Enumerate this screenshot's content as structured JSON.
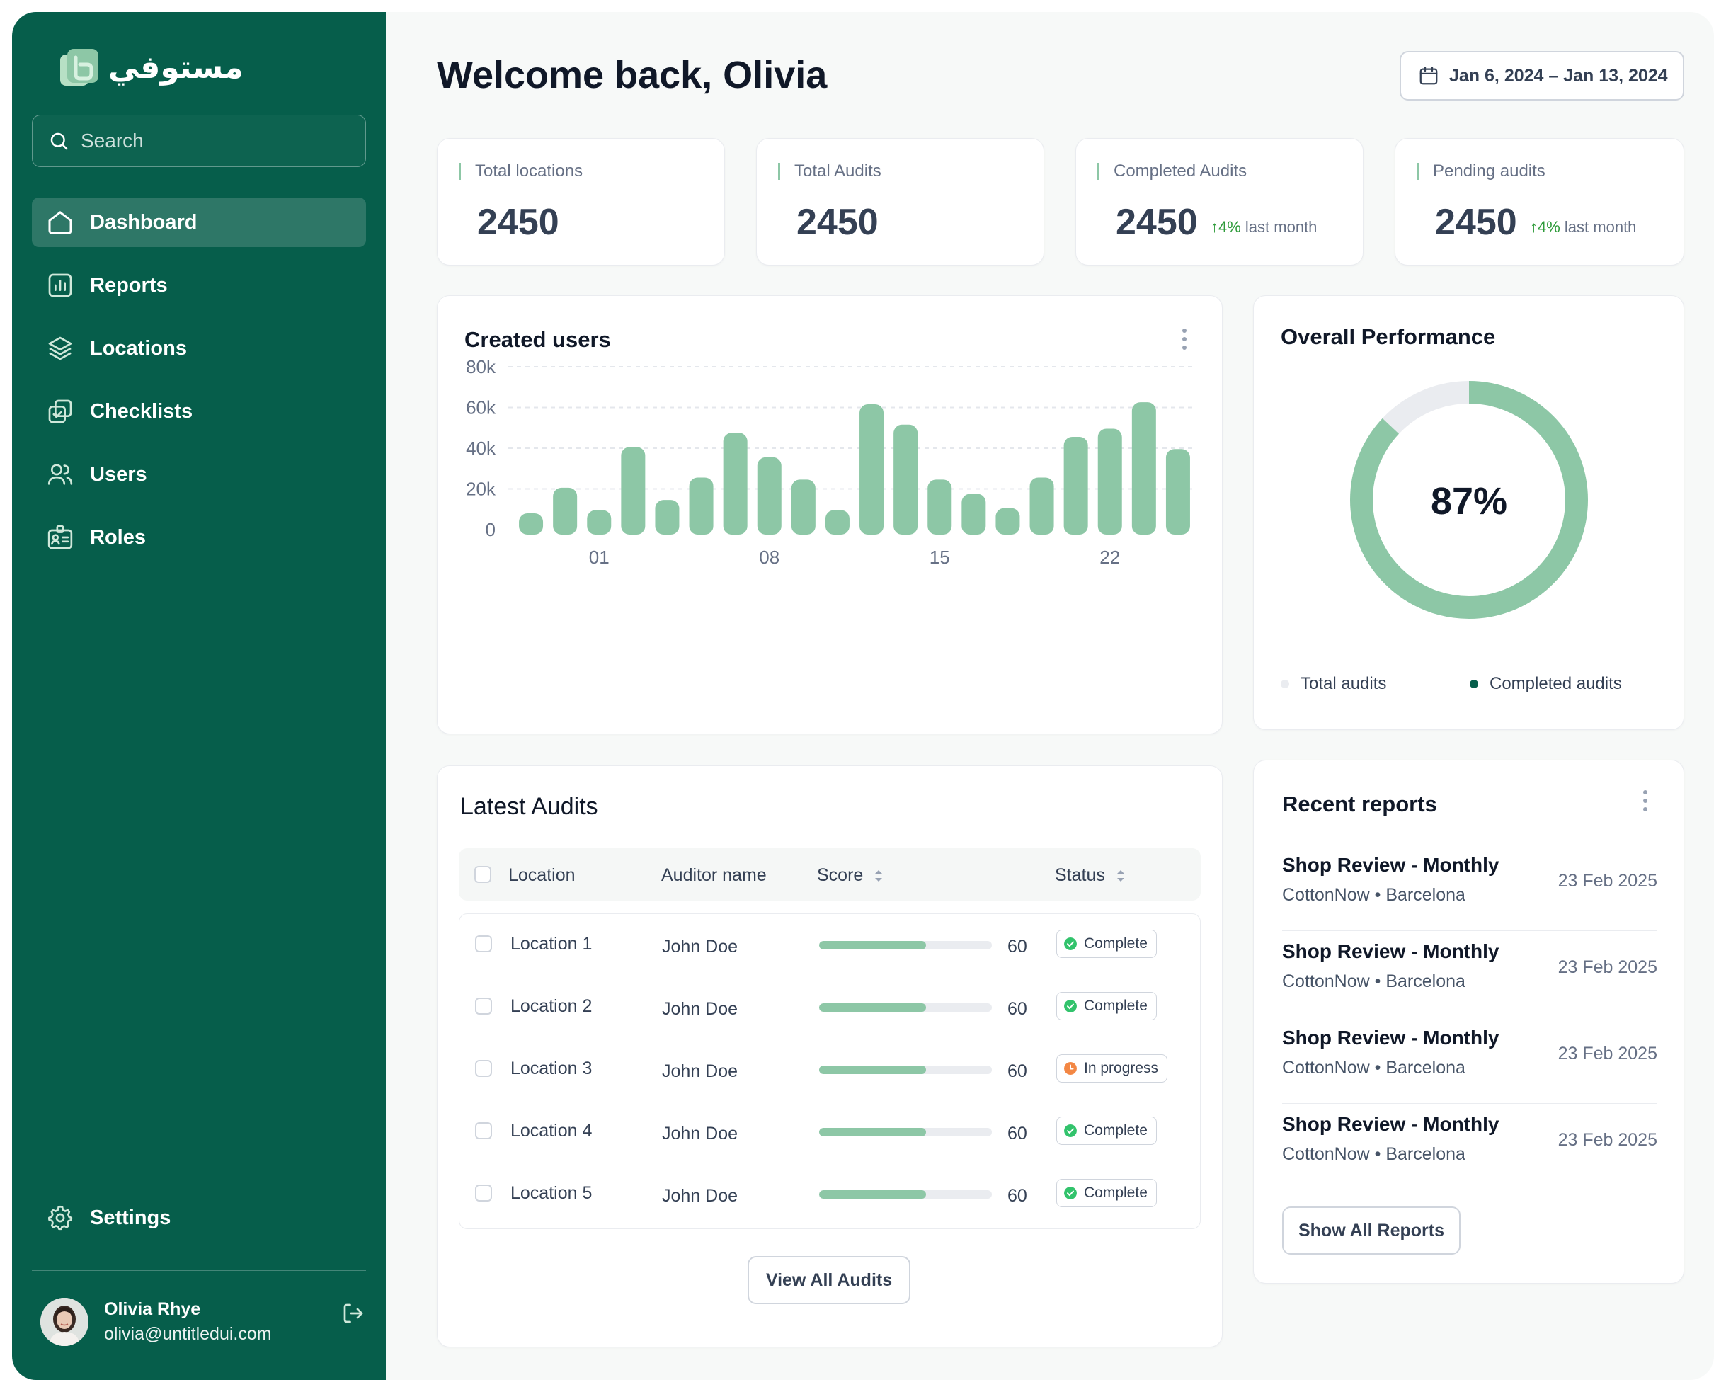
{
  "app": {
    "logo_text": "مستوفي"
  },
  "search": {
    "placeholder": "Search"
  },
  "sidebar": {
    "items": [
      {
        "label": "Dashboard",
        "icon": "home-icon",
        "active": true
      },
      {
        "label": "Reports",
        "icon": "bar-chart-icon"
      },
      {
        "label": "Locations",
        "icon": "layers-icon"
      },
      {
        "label": "Checklists",
        "icon": "checklist-icon"
      },
      {
        "label": "Users",
        "icon": "users-icon"
      },
      {
        "label": "Roles",
        "icon": "id-badge-icon"
      }
    ],
    "settings_label": "Settings",
    "user": {
      "name": "Olivia Rhye",
      "email": "olivia@untitledui.com"
    }
  },
  "header": {
    "welcome": "Welcome back, Olivia",
    "date_range": "Jan 6, 2024 – Jan 13, 2024"
  },
  "stats": [
    {
      "label": "Total locations",
      "value": "2450"
    },
    {
      "label": "Total Audits",
      "value": "2450"
    },
    {
      "label": "Completed Audits",
      "value": "2450",
      "trend": "4%",
      "trend_suffix": "last month"
    },
    {
      "label": "Pending audits",
      "value": "2450",
      "trend": "4%",
      "trend_suffix": "last month"
    }
  ],
  "created_users": {
    "title": "Created users",
    "chart_data": {
      "type": "bar",
      "x_tick_labels": [
        "01",
        "08",
        "15",
        "22"
      ],
      "x_tick_positions": [
        3,
        8,
        13,
        18
      ],
      "values": [
        5000,
        23000,
        12000,
        43000,
        17000,
        28000,
        50000,
        38000,
        27000,
        12000,
        64000,
        54000,
        27000,
        20000,
        13000,
        28000,
        48000,
        52000,
        65000,
        42000
      ],
      "ylim": [
        0,
        80000
      ],
      "y_ticks": [
        0,
        20000,
        40000,
        60000,
        80000
      ],
      "y_tick_labels": [
        "0",
        "20k",
        "40k",
        "60k",
        "80k"
      ],
      "grid": true,
      "color": "#8dc7a6"
    }
  },
  "performance": {
    "title": "Overall Performance",
    "value_label": "87%",
    "chart_data": {
      "type": "pie",
      "values": [
        87,
        13
      ],
      "colors": [
        "#8dc7a6",
        "#eaecf0"
      ]
    },
    "legend": [
      {
        "label": "Total audits",
        "color": "#eaecf0"
      },
      {
        "label": "Completed audits",
        "color": "#065e4b"
      }
    ]
  },
  "audits": {
    "title": "Latest Audits",
    "columns": [
      "Location",
      "Auditor name",
      "Score",
      "Status"
    ],
    "rows": [
      {
        "location": "Location 1",
        "auditor": "John Doe",
        "score": "60",
        "score_pct": 62,
        "status": "Complete",
        "status_color": "#32c36c"
      },
      {
        "location": "Location 2",
        "auditor": "John Doe",
        "score": "60",
        "score_pct": 62,
        "status": "Complete",
        "status_color": "#32c36c"
      },
      {
        "location": "Location 3",
        "auditor": "John Doe",
        "score": "60",
        "score_pct": 62,
        "status": "In progress",
        "status_color": "#f38744"
      },
      {
        "location": "Location 4",
        "auditor": "John Doe",
        "score": "60",
        "score_pct": 62,
        "status": "Complete",
        "status_color": "#32c36c"
      },
      {
        "location": "Location 5",
        "auditor": "John Doe",
        "score": "60",
        "score_pct": 62,
        "status": "Complete",
        "status_color": "#32c36c"
      }
    ],
    "view_all": "View All Audits"
  },
  "reports": {
    "title": "Recent reports",
    "items": [
      {
        "title": "Shop Review - Monthly",
        "org": "CottonNow",
        "city": "Barcelona",
        "date": "23 Feb 2025"
      },
      {
        "title": "Shop Review - Monthly",
        "org": "CottonNow",
        "city": "Barcelona",
        "date": "23 Feb 2025"
      },
      {
        "title": "Shop Review - Monthly",
        "org": "CottonNow",
        "city": "Barcelona",
        "date": "23 Feb 2025"
      },
      {
        "title": "Shop Review - Monthly",
        "org": "CottonNow",
        "city": "Barcelona",
        "date": "23 Feb 2025"
      }
    ],
    "show_all": "Show All Reports"
  }
}
